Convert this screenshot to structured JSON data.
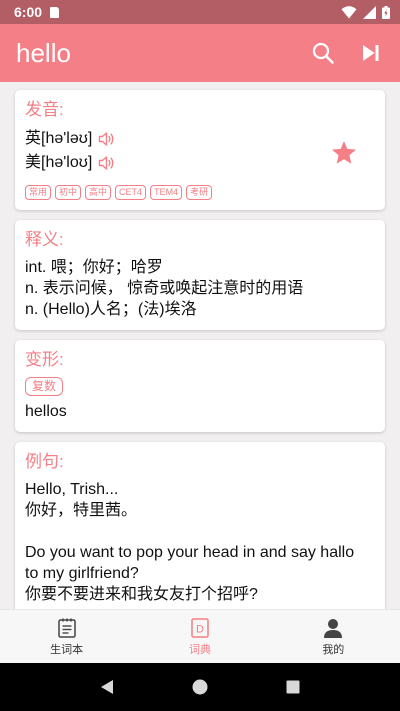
{
  "status_bar": {
    "time": "6:00"
  },
  "app_bar": {
    "title": "hello"
  },
  "pronunciation": {
    "title": "发音:",
    "uk": "英[hə'ləʊ]",
    "us": "美[hə'loʊ]",
    "tags": [
      "常用",
      "初中",
      "高中",
      "CET4",
      "TEM4",
      "考研"
    ]
  },
  "definition": {
    "title": "释义:",
    "lines": [
      "int. 喂；你好；哈罗",
      "n. 表示问候， 惊奇或唤起注意时的用语",
      "n. (Hello)人名；(法)埃洛"
    ]
  },
  "inflection": {
    "title": "变形:",
    "tag": "复数",
    "word": "hellos"
  },
  "examples": {
    "title": "例句:",
    "items": [
      {
        "en": "Hello, Trish...",
        "zh": "你好，特里茜。"
      },
      {
        "en_lines": [
          "Do you want to pop your head in and say hallo",
          "to my girlfriend?"
        ],
        "zh": "你要不要进来和我女友打个招呼?"
      }
    ]
  },
  "bottom_nav": {
    "items": [
      {
        "label": "生词本",
        "icon": "notebook-icon"
      },
      {
        "label": "词典",
        "icon": "dictionary-icon"
      },
      {
        "label": "我的",
        "icon": "person-icon"
      }
    ],
    "active_index": 1
  },
  "colors": {
    "accent": "#f47f87",
    "status_bar": "#b35d64"
  }
}
